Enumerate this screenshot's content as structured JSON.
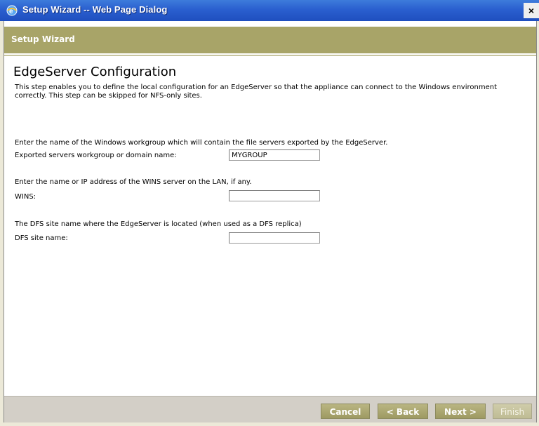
{
  "window": {
    "title": "Setup Wizard -- Web Page Dialog",
    "close_glyph": "×",
    "icon": "ie-globe-icon"
  },
  "header": {
    "title": "Setup Wizard",
    "band_color": "#a8a468"
  },
  "main": {
    "title": "EdgeServer Configuration",
    "description": "This step enables you to define the local configuration for an EdgeServer so that the appliance can connect to the Windows environment correctly. This step can be skipped for NFS-only sites.",
    "workgroup_intro": "Enter the name of the Windows workgroup which will contain the file servers exported by the EdgeServer.",
    "workgroup_label": "Exported servers workgroup or domain name:",
    "workgroup_value": "MYGROUP",
    "wins_intro": "Enter the name or IP address of the WINS server on the LAN, if any.",
    "wins_label": "WINS:",
    "wins_value": "",
    "dfs_intro": "The DFS site name where the EdgeServer is located (when used as a DFS replica)",
    "dfs_label": "DFS site name:",
    "dfs_value": ""
  },
  "footer": {
    "cancel_label": "Cancel",
    "back_label": "< Back",
    "next_label": "Next >",
    "finish_label": "Finish",
    "finish_enabled": false
  }
}
